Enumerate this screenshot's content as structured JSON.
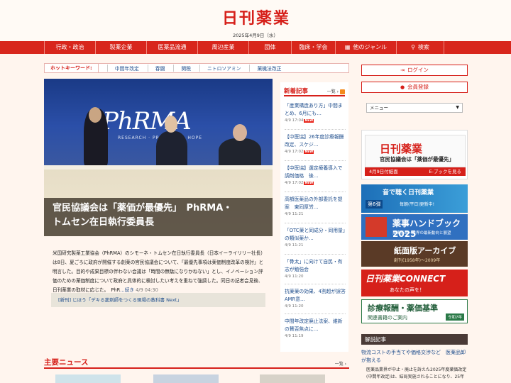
{
  "site": {
    "logo": "日刊薬業",
    "date": "2025年4月9日（水）"
  },
  "nav": {
    "items": [
      {
        "label": "行政・政治",
        "icon": ""
      },
      {
        "label": "製薬企業",
        "icon": ""
      },
      {
        "label": "医薬品流通",
        "icon": ""
      },
      {
        "label": "周辺産業",
        "icon": ""
      },
      {
        "label": "団体",
        "icon": ""
      },
      {
        "label": "臨床・学会",
        "icon": ""
      },
      {
        "label": "他のジャンル",
        "icon": "grid-icon"
      },
      {
        "label": "検索",
        "icon": "search-icon"
      }
    ]
  },
  "hotword": {
    "label": "ホットキーワード:",
    "items": [
      "中間年改定",
      "春闘",
      "関税",
      "ニトロソアミン",
      "薬機法改正"
    ]
  },
  "feature": {
    "title_line1": "官民協議会は「薬価が最優先」　PhRMA・",
    "title_line2": "トムセン在日執行委員長",
    "photo_logo": "PhRMA",
    "photo_sub": "RESEARCH · PROGRESS · HOPE",
    "lead": "米国研究製薬工業協会（PhRMA）のシモーネ・トムセン在日執行委員長（日本イーライリリー社長）は8日、夏ごろに政府が開催する創薬の官民協議会について、「最優先事項は薬価制度改革の検討」と明言した。目的や成果目標の伴わない会議は「時間の無駄になりかねない」とし、イノベーション評価のための薬価制度について政府と具体的に検討したい考えを重ねて強調した。同日の記者会見後、日刊薬業の取材に応じた。",
    "lead_tail": "PhR",
    "more": "…続き",
    "time": "4/9 04:30",
    "related": "[新刊] じほう「デキる薬剤師をつくる現場の教科書 Next」"
  },
  "main_news": {
    "title": "主要ニュース",
    "more": "一覧 ›"
  },
  "new_articles": {
    "title": "新着記事",
    "more": "一覧 ›",
    "items": [
      {
        "title": "「産業構造あり方」中間まとめ、6月にも…",
        "time": "4/9 17:04",
        "new": true
      },
      {
        "title": "【中医協】26年度診療報酬改定、スケジ…",
        "time": "4/9 17:02",
        "new": true
      },
      {
        "title": "【中医協】選定療養導入で調剤価格　後…",
        "time": "4/9 17:02",
        "new": true
      },
      {
        "title": "高額医薬品の外部委託を提案　東同厚労…",
        "time": "4/9 11:21",
        "new": false
      },
      {
        "title": "「OTC薬と同成分・同用量」の類似薬か…",
        "time": "4/9 11:21",
        "new": false
      },
      {
        "title": "「骨太」に向けて自民・有志が勉強会",
        "time": "4/9 11:20",
        "new": false
      },
      {
        "title": "抗薬薬の効果、4割超が誤答　AMR意…",
        "time": "4/9 11:20",
        "new": false
      },
      {
        "title": "中間年改定廃止法案、維新の賛否焦点に…",
        "time": "4/9 11:19",
        "new": false
      }
    ],
    "new_label": "NEW"
  },
  "account": {
    "login": "ログイン",
    "register": "会員登録",
    "menu": "メニュー"
  },
  "banners": {
    "paper_logo": "日刊薬業",
    "paper_head": "官民協議会は「薬価が最優先」",
    "paper_date": "4月9日付紙面",
    "paper_ebook": "E-ブックを見る",
    "audio_title": "音で聴く日刊薬業",
    "audio_episode": "第6弾",
    "audio_sub": "毎朝(平日)更新中!",
    "handbook_title": "薬事ハンドブック2025",
    "handbook_sub": "薬事行政・業界の最新動向と展望",
    "archive_title": "紙面版アーカイブ",
    "archive_sub": "創刊(1958年)〜2009年",
    "connect_title": "日刊薬業CONNECT",
    "connect_sub": "あなたの声を！",
    "kijun_title": "診療報酬・薬価基準",
    "kijun_sub": "関連書籍のご案内",
    "kijun_badge": "令和7年"
  },
  "explain": {
    "head": "解説記事",
    "item": "物流コストの手当てや価格交渉など　医薬品卸が抱える",
    "body": "医薬品業界が中止・廃止を訴えた2025年度薬価改定(中間年改定)は、結局実施されることになり、25年"
  }
}
